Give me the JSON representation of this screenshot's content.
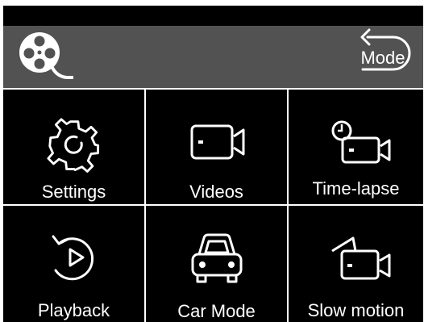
{
  "colors": {
    "screen_bg": "#000000",
    "header_bg": "#525252",
    "foreground": "#ffffff"
  },
  "header": {
    "logo_icon": "film-reel-icon",
    "mode_button": {
      "label": "Mode",
      "icon": "return-arrow-icon"
    }
  },
  "menu": [
    {
      "label": "Settings",
      "icon": "gear-icon"
    },
    {
      "label": "Videos",
      "icon": "video-camera-icon"
    },
    {
      "label": "Time-lapse",
      "icon": "timelapse-camera-icon"
    },
    {
      "label": "Playback",
      "icon": "replay-icon"
    },
    {
      "label": "Car Mode",
      "icon": "car-icon"
    },
    {
      "label": "Slow motion",
      "icon": "slow-motion-camera-icon"
    }
  ]
}
